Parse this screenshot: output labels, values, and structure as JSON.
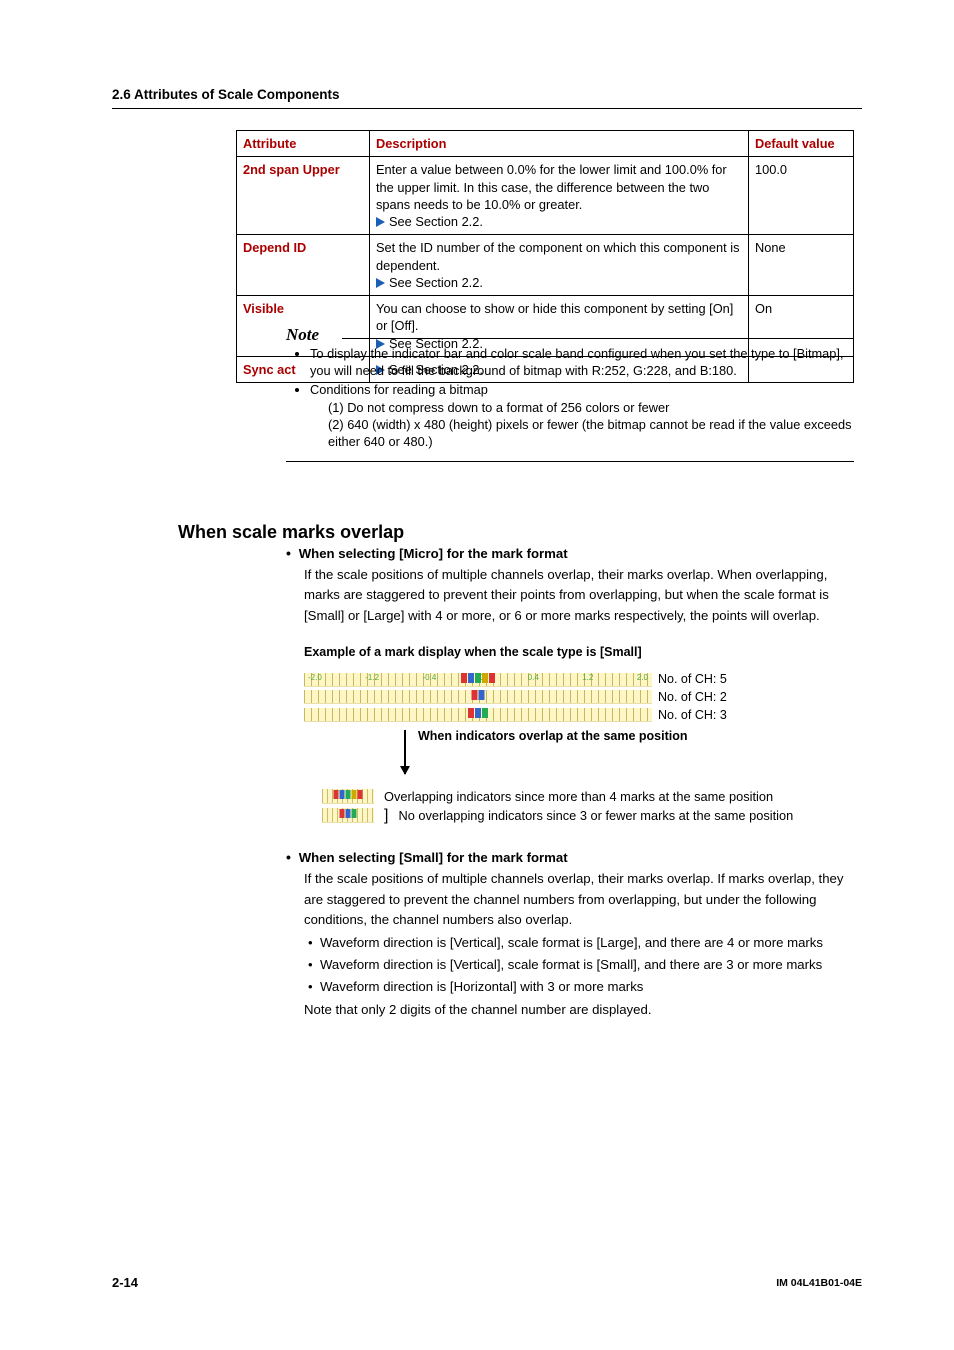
{
  "section_header": "2.6  Attributes of Scale Components",
  "table": {
    "headers": {
      "attr": "Attribute",
      "desc": "Description",
      "def": "Default value"
    },
    "rows": [
      {
        "attr": "2nd span Upper",
        "desc": "Enter a value between 0.0% for the lower limit and 100.0% for the upper limit. In this case, the difference between the two spans needs to be 10.0% or greater.",
        "see": "See Section 2.2.",
        "def": "100.0"
      },
      {
        "attr": "Depend ID",
        "desc": "Set the ID number of the component on which this component is dependent.",
        "see": "See Section 2.2.",
        "def": "None"
      },
      {
        "attr": "Visible",
        "desc": "You can choose to show or hide this component by setting [On] or [Off].",
        "see": "See Section 2.2.",
        "def": "On"
      },
      {
        "attr": "Sync act",
        "desc": "",
        "see": "See Section 2.2.",
        "def": ""
      }
    ]
  },
  "note": {
    "title": "Note",
    "items": [
      "To display the indicator bar and color scale band configured when you set the type to [Bitmap], you will need to fill the background of bitmap with R:252, G:228, and B:180.",
      "Conditions for reading a bitmap"
    ],
    "sub": [
      "(1) Do not compress down to a format of 256 colors or fewer",
      "(2) 640 (width) x 480 (height) pixels or fewer (the bitmap cannot be read if the value exceeds either 640 or 480.)"
    ]
  },
  "overlap": {
    "heading": "When scale marks overlap",
    "micro": {
      "title": "When selecting [Micro] for the mark format",
      "body": "If the scale positions of multiple channels overlap, their marks overlap. When overlapping, marks are staggered to prevent their points from overlapping, but when the scale format is [Small] or [Large] with 4 or more, or 6 or more marks respectively, the points will overlap.",
      "caption": "Example of a mark display when the scale type is [Small]",
      "rows": [
        "No. of CH: 5",
        "No. of CH: 2",
        "No. of CH: 3"
      ],
      "tick_labels": [
        "-2.0",
        "-1.2",
        "-0.4",
        "0",
        "0.4",
        "1.2",
        "2.0"
      ],
      "arrow_text": "When indicators overlap at the same position",
      "ovl1": "Overlapping indicators since more than 4 marks at the same position",
      "ovl2": "No overlapping indicators since 3 or fewer marks at the same position"
    },
    "small": {
      "title": "When selecting [Small] for the mark format",
      "body": "If the scale positions of multiple channels overlap, their marks overlap. If marks overlap, they are staggered to prevent the channel numbers from overlapping, but under the following conditions, the channel numbers also overlap.",
      "bullets": [
        "Waveform direction is [Vertical], scale format is [Large], and there are 4 or more marks",
        "Waveform direction is [Vertical], scale format is [Small], and there are 3 or more marks",
        "Waveform direction is [Horizontal] with 3 or more marks"
      ],
      "tail": "Note that only 2 digits of the channel number are displayed."
    }
  },
  "footer": {
    "page": "2-14",
    "doc": "IM 04L41B01-04E"
  }
}
